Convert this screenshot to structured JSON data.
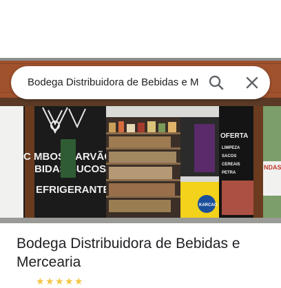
{
  "search": {
    "query": "Bodega Distribuidora de Bebidas e M"
  },
  "photo": {
    "sign_left_lines": [
      "C MBOS  CARVÃO",
      "BIDAS  SUCOS",
      "EFRIGERANTES"
    ],
    "sign_right_lines": [
      "OFERTA",
      "LIMPEZA",
      "SACOS",
      "CEREAIS",
      "PETRA"
    ],
    "freezer_brand": "KARCAO",
    "edge_sign": "NDAS"
  },
  "place": {
    "title": "Bodega Distribuidora de Bebidas e Mercearia"
  },
  "colors": {
    "roof": "#a0522d",
    "wall": "#1b1b1b",
    "freezer": "#f2d21a",
    "star": "#f4c542"
  }
}
